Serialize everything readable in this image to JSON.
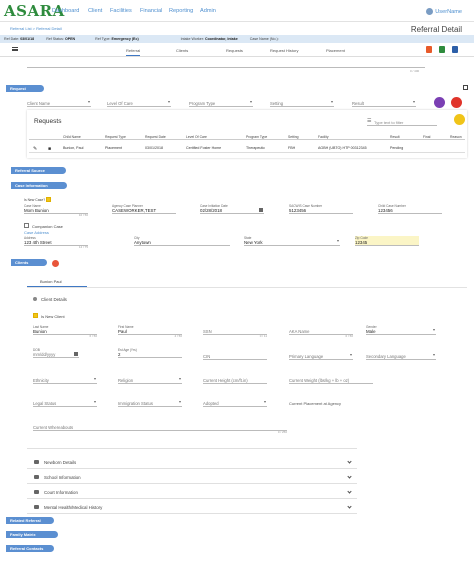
{
  "brand": {
    "logo": "ASARA",
    "accent": "#2e8b3d",
    "link_color": "#4e8fcf",
    "pill_color": "#5b8fd1"
  },
  "nav": {
    "items": [
      "Dashboard",
      "Client",
      "Facilities",
      "Financial",
      "Reporting",
      "Admin"
    ],
    "user": "UserName"
  },
  "breadcrumb": "Referral List > Referral Detail",
  "page_title": "Referral Detail",
  "info": {
    "ref_date_label": "Ref Date:",
    "ref_date": "03/01/18",
    "ref_status_label": "Ref Status:",
    "ref_status": "OPEN",
    "ref_type_label": "Ref Type:",
    "ref_type": "Emergency (Ec)",
    "intake_label": "Intake Worker:",
    "intake": "Coordinator, Intake",
    "case_label": "Case Name (No.):",
    "case": ""
  },
  "tabs": [
    "Referral",
    "Clients",
    "Requests",
    "Request History",
    "Placement"
  ],
  "top_counter": "0 / 400",
  "sections": {
    "request": "Request",
    "referral_source": "Referral Source",
    "case_info": "Case Information",
    "clients": "Clients",
    "related_referral": "Related Referral",
    "family_matrix": "Family Matrix",
    "referral_contacts": "Referral Contacts"
  },
  "request_filters": [
    "Client Name",
    "Level Of Care",
    "Program Type",
    "Setting",
    "Result"
  ],
  "requests": {
    "title": "Requests",
    "filter_placeholder": "Type text to filter",
    "columns": [
      "Child Name",
      "Request Type",
      "Request Date",
      "Level Of Care",
      "Program Type",
      "Setting",
      "Facility",
      "Result",
      "Final",
      "Reason"
    ],
    "rows": [
      [
        "Bunion, Paul",
        "Placement",
        "03/01/2018",
        "Certified Foster Home",
        "Therapeutic",
        "FBH",
        "AGBH (UBTO) HTP 00312345",
        "Pending",
        "",
        ""
      ]
    ]
  },
  "case": {
    "is_new_case_label": "Is New Case?",
    "case_name_label": "Case Name",
    "case_name": "Mom Bunion",
    "case_name_count": "10 / 50",
    "agency_label": "Agency Case Planner",
    "agency": "CASEWORKER,TEST",
    "open_date_label": "Case Initiation Date",
    "open_date": "02/28/2018",
    "sacwis_label": "SACWIS Case Number",
    "sacwis": "5123456",
    "child_case_label": "Child Case Number",
    "child_case": "123456",
    "companion_label": "Companion Case",
    "address_link": "Case Address",
    "address_label": "Address",
    "address": "123 4th Street",
    "address_count": "14 / 75",
    "city_label": "City",
    "city": "Anytown",
    "state_label": "State",
    "state": "New York",
    "zip_label": "Zip Code",
    "zip": "12345"
  },
  "client_tab": "Bunion Paul",
  "client": {
    "details_label": "Client Details",
    "is_new_label": "Is New Client",
    "last_name_label": "Last Name",
    "last_name": "Bunion",
    "last_count": "6 / 50",
    "first_name_label": "First Name",
    "first_name": "Paul",
    "first_count": "4 / 50",
    "ssn_label": "SSN",
    "ssn_count": "0 / 11",
    "aka_label": "AKA Name",
    "aka_count": "0 / 50",
    "gender_label": "Gender",
    "gender": "Male",
    "dob_label": "DOB",
    "dob_placeholder": "mm/dd/yyyy",
    "age_label": "Est Age (Yrs)",
    "age": "2",
    "cin_label": "CIN",
    "primary_lang": "Primary Language",
    "secondary_lang": "Secondary Language",
    "ethnicity": "Ethnicity",
    "religion": "Religion",
    "height": "Current Height (cm/ft.in)",
    "weight": "Current Weight (lbs/kg + lb + oz)",
    "legal": "Legal Status",
    "immigration": "Immigration Status",
    "adopted": "Adopted",
    "placement_label": "Current Placement at Agency",
    "whereabouts": "Current Whereabouts",
    "whereabouts_count": "0 / 250"
  },
  "accordions": [
    "Newborn Details",
    "School Information",
    "Court Information",
    "Mental Health/Medical History"
  ]
}
